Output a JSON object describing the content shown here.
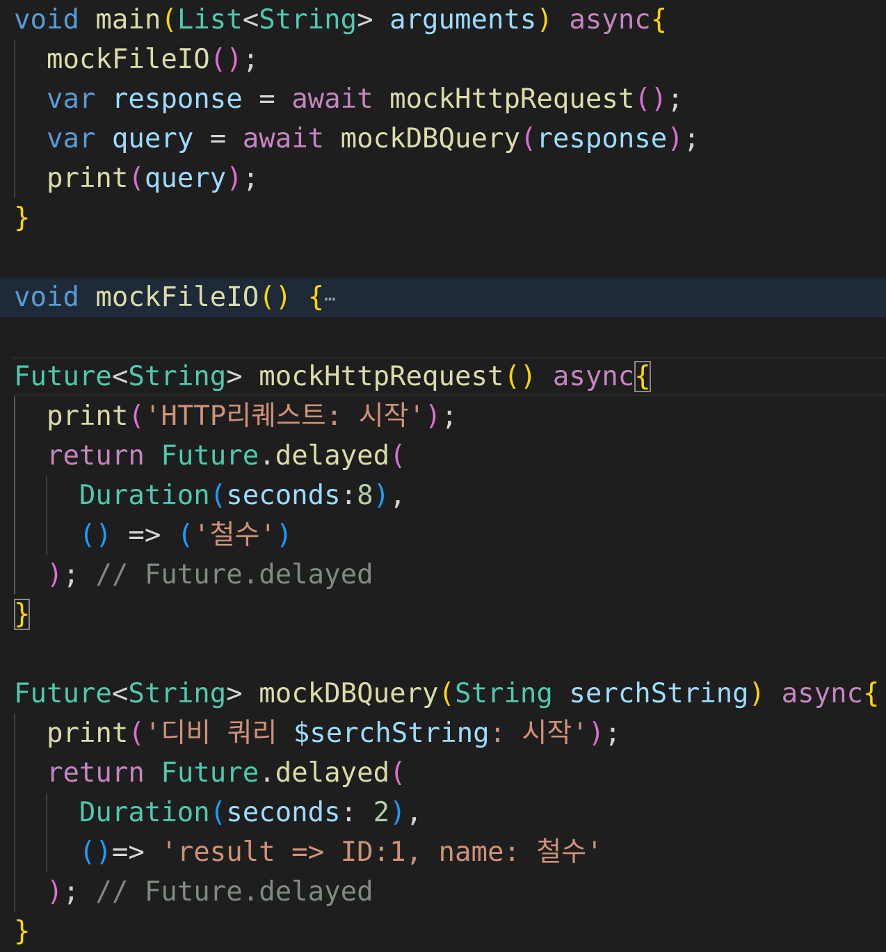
{
  "editor": {
    "fold_ellipsis": "⋯",
    "lines": [
      {
        "tokens": [
          [
            "void",
            "kw"
          ],
          [
            " ",
            "pn"
          ],
          [
            "main",
            "fn"
          ],
          [
            "(",
            "b1"
          ],
          [
            "List",
            "ty"
          ],
          [
            "<",
            "pn"
          ],
          [
            "String",
            "ty"
          ],
          [
            "> ",
            "pn"
          ],
          [
            "arguments",
            "vr"
          ],
          [
            ")",
            "b1"
          ],
          [
            " ",
            "pn"
          ],
          [
            "async",
            "ctl"
          ],
          [
            "{",
            "b1"
          ]
        ]
      },
      {
        "tokens": [
          [
            "  ",
            "pn"
          ],
          [
            "mockFileIO",
            "fn"
          ],
          [
            "(",
            "b2"
          ],
          [
            ")",
            "b2"
          ],
          [
            ";",
            "pn"
          ]
        ]
      },
      {
        "tokens": [
          [
            "  ",
            "pn"
          ],
          [
            "var",
            "kw"
          ],
          [
            " ",
            "pn"
          ],
          [
            "response",
            "vr"
          ],
          [
            " = ",
            "pn"
          ],
          [
            "await",
            "ctl"
          ],
          [
            " ",
            "pn"
          ],
          [
            "mockHttpRequest",
            "fn"
          ],
          [
            "(",
            "b2"
          ],
          [
            ")",
            "b2"
          ],
          [
            ";",
            "pn"
          ]
        ]
      },
      {
        "tokens": [
          [
            "  ",
            "pn"
          ],
          [
            "var",
            "kw"
          ],
          [
            " ",
            "pn"
          ],
          [
            "query",
            "vr"
          ],
          [
            " = ",
            "pn"
          ],
          [
            "await",
            "ctl"
          ],
          [
            " ",
            "pn"
          ],
          [
            "mockDBQuery",
            "fn"
          ],
          [
            "(",
            "b2"
          ],
          [
            "response",
            "vr"
          ],
          [
            ")",
            "b2"
          ],
          [
            ";",
            "pn"
          ]
        ]
      },
      {
        "tokens": [
          [
            "  ",
            "pn"
          ],
          [
            "print",
            "fn"
          ],
          [
            "(",
            "b2"
          ],
          [
            "query",
            "vr"
          ],
          [
            ")",
            "b2"
          ],
          [
            ";",
            "pn"
          ]
        ]
      },
      {
        "tokens": [
          [
            "}",
            "b1"
          ]
        ]
      },
      {
        "tokens": []
      },
      {
        "tokens": [
          [
            "void",
            "kw"
          ],
          [
            " ",
            "pn"
          ],
          [
            "mockFileIO",
            "fn"
          ],
          [
            "(",
            "b1"
          ],
          [
            ")",
            "b1"
          ],
          [
            " ",
            "pn"
          ],
          [
            "{",
            "b1"
          ]
        ],
        "folded": true
      },
      {
        "tokens": []
      },
      {
        "tokens": [
          [
            "Future",
            "ty"
          ],
          [
            "<",
            "pn"
          ],
          [
            "String",
            "ty"
          ],
          [
            "> ",
            "pn"
          ],
          [
            "mockHttpRequest",
            "fn"
          ],
          [
            "(",
            "b1"
          ],
          [
            ")",
            "b1"
          ],
          [
            " ",
            "pn"
          ],
          [
            "async",
            "ctl"
          ],
          [
            "{",
            "b1"
          ]
        ],
        "current": true
      },
      {
        "tokens": [
          [
            "  ",
            "pn"
          ],
          [
            "print",
            "fn"
          ],
          [
            "(",
            "b2"
          ],
          [
            "'HTTP리퀘스트: 시작'",
            "st"
          ],
          [
            ")",
            "b2"
          ],
          [
            ";",
            "pn"
          ]
        ]
      },
      {
        "tokens": [
          [
            "  ",
            "pn"
          ],
          [
            "return",
            "ctl"
          ],
          [
            " ",
            "pn"
          ],
          [
            "Future",
            "ty"
          ],
          [
            ".",
            "pn"
          ],
          [
            "delayed",
            "fn"
          ],
          [
            "(",
            "b2"
          ]
        ]
      },
      {
        "tokens": [
          [
            "    ",
            "pn"
          ],
          [
            "Duration",
            "ty"
          ],
          [
            "(",
            "b3"
          ],
          [
            "seconds",
            "vr"
          ],
          [
            ":",
            "pn"
          ],
          [
            "8",
            "nm"
          ],
          [
            ")",
            "b3"
          ],
          [
            ",",
            "pn"
          ]
        ]
      },
      {
        "tokens": [
          [
            "    ",
            "pn"
          ],
          [
            "(",
            "b3"
          ],
          [
            ")",
            "b3"
          ],
          [
            " => ",
            "pn"
          ],
          [
            "(",
            "b3"
          ],
          [
            "'철수'",
            "st"
          ],
          [
            ")",
            "b3"
          ]
        ]
      },
      {
        "tokens": [
          [
            "  ",
            "pn"
          ],
          [
            ")",
            "b2"
          ],
          [
            ";",
            "pn"
          ],
          [
            " ",
            "pn"
          ],
          [
            "// Future.delayed",
            "cm"
          ]
        ]
      },
      {
        "tokens": [
          [
            "}",
            "b1"
          ]
        ]
      },
      {
        "tokens": []
      },
      {
        "tokens": [
          [
            "Future",
            "ty"
          ],
          [
            "<",
            "pn"
          ],
          [
            "String",
            "ty"
          ],
          [
            "> ",
            "pn"
          ],
          [
            "mockDBQuery",
            "fn"
          ],
          [
            "(",
            "b1"
          ],
          [
            "String",
            "ty"
          ],
          [
            " ",
            "pn"
          ],
          [
            "serchString",
            "vr"
          ],
          [
            ")",
            "b1"
          ],
          [
            " ",
            "pn"
          ],
          [
            "async",
            "ctl"
          ],
          [
            "{",
            "b1"
          ]
        ]
      },
      {
        "tokens": [
          [
            "  ",
            "pn"
          ],
          [
            "print",
            "fn"
          ],
          [
            "(",
            "b2"
          ],
          [
            "'디비 쿼리 ",
            "st"
          ],
          [
            "$serchString",
            "vr"
          ],
          [
            ": 시작'",
            "st"
          ],
          [
            ")",
            "b2"
          ],
          [
            ";",
            "pn"
          ]
        ]
      },
      {
        "tokens": [
          [
            "  ",
            "pn"
          ],
          [
            "return",
            "ctl"
          ],
          [
            " ",
            "pn"
          ],
          [
            "Future",
            "ty"
          ],
          [
            ".",
            "pn"
          ],
          [
            "delayed",
            "fn"
          ],
          [
            "(",
            "b2"
          ]
        ]
      },
      {
        "tokens": [
          [
            "    ",
            "pn"
          ],
          [
            "Duration",
            "ty"
          ],
          [
            "(",
            "b3"
          ],
          [
            "seconds",
            "vr"
          ],
          [
            ": ",
            "pn"
          ],
          [
            "2",
            "nm"
          ],
          [
            ")",
            "b3"
          ],
          [
            ",",
            "pn"
          ]
        ]
      },
      {
        "tokens": [
          [
            "    ",
            "pn"
          ],
          [
            "(",
            "b3"
          ],
          [
            ")",
            "b3"
          ],
          [
            "=> ",
            "pn"
          ],
          [
            "'result => ID:1, name: 철수'",
            "st"
          ]
        ]
      },
      {
        "tokens": [
          [
            "  ",
            "pn"
          ],
          [
            ")",
            "b2"
          ],
          [
            ";",
            "pn"
          ],
          [
            " ",
            "pn"
          ],
          [
            "// Future.delayed",
            "cm"
          ]
        ]
      },
      {
        "tokens": [
          [
            "}",
            "b1"
          ]
        ]
      }
    ]
  }
}
